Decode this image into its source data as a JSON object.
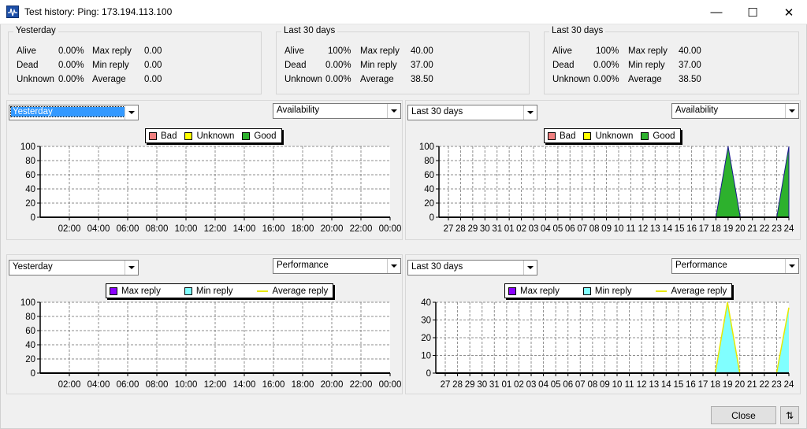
{
  "window": {
    "title": "Test history: Ping: 173.194.113.100",
    "min_glyph": "—",
    "max_glyph": "☐",
    "close_glyph": "✕"
  },
  "stats": [
    {
      "legend": "Yesterday",
      "rows": [
        {
          "label": "Alive",
          "pct": "0.00%",
          "metric": "Max reply",
          "value": "0.00"
        },
        {
          "label": "Dead",
          "pct": "0.00%",
          "metric": "Min reply",
          "value": "0.00"
        },
        {
          "label": "Unknown",
          "pct": "0.00%",
          "metric": "Average",
          "value": "0.00"
        }
      ]
    },
    {
      "legend": "Last 30 days",
      "rows": [
        {
          "label": "Alive",
          "pct": "100%",
          "metric": "Max reply",
          "value": "40.00"
        },
        {
          "label": "Dead",
          "pct": "0.00%",
          "metric": "Min reply",
          "value": "37.00"
        },
        {
          "label": "Unknown",
          "pct": "0.00%",
          "metric": "Average",
          "value": "38.50"
        }
      ]
    },
    {
      "legend": "Last 30 days",
      "rows": [
        {
          "label": "Alive",
          "pct": "100%",
          "metric": "Max reply",
          "value": "40.00"
        },
        {
          "label": "Dead",
          "pct": "0.00%",
          "metric": "Min reply",
          "value": "37.00"
        },
        {
          "label": "Unknown",
          "pct": "0.00%",
          "metric": "Average",
          "value": "38.50"
        }
      ]
    }
  ],
  "panels": [
    {
      "period": "Yesterday",
      "mode": "Availability",
      "legend": [
        "Bad",
        "Unknown",
        "Good"
      ]
    },
    {
      "period": "Last 30 days",
      "mode": "Availability",
      "legend": [
        "Bad",
        "Unknown",
        "Good"
      ]
    },
    {
      "period": "Yesterday",
      "mode": "Performance",
      "legend": [
        "Max reply",
        "Min reply",
        "Average reply"
      ]
    },
    {
      "period": "Last 30 days",
      "mode": "Performance",
      "legend": [
        "Max reply",
        "Min reply",
        "Average reply"
      ]
    }
  ],
  "colors": {
    "bad": "#f08080",
    "unknown": "#ffff00",
    "good": "#2db12d",
    "max_reply": "#8b00ff",
    "min_reply": "#80ffff",
    "avg_reply": "#e8e800"
  },
  "buttons": {
    "close": "Close",
    "resize_glyph": "⇅"
  },
  "chart_data": [
    {
      "type": "area",
      "title": "",
      "x": [
        "02:00",
        "04:00",
        "06:00",
        "08:00",
        "10:00",
        "12:00",
        "14:00",
        "16:00",
        "18:00",
        "20:00",
        "22:00",
        "00:00"
      ],
      "yticks": [
        0,
        20,
        40,
        60,
        80,
        100
      ],
      "ylim": [
        0,
        100
      ],
      "grid": true,
      "legend": "top-center",
      "series": [
        {
          "name": "Bad",
          "values": [
            0,
            0,
            0,
            0,
            0,
            0,
            0,
            0,
            0,
            0,
            0,
            0
          ]
        },
        {
          "name": "Unknown",
          "values": [
            0,
            0,
            0,
            0,
            0,
            0,
            0,
            0,
            0,
            0,
            0,
            0
          ]
        },
        {
          "name": "Good",
          "values": [
            0,
            0,
            0,
            0,
            0,
            0,
            0,
            0,
            0,
            0,
            0,
            0
          ]
        }
      ]
    },
    {
      "type": "area",
      "title": "",
      "x": [
        "27",
        "28",
        "29",
        "30",
        "31",
        "01",
        "02",
        "03",
        "04",
        "05",
        "06",
        "07",
        "08",
        "09",
        "10",
        "11",
        "12",
        "13",
        "14",
        "15",
        "16",
        "17",
        "18",
        "19",
        "20",
        "21",
        "22",
        "23",
        "24"
      ],
      "yticks": [
        0,
        20,
        40,
        60,
        80,
        100
      ],
      "ylim": [
        0,
        100
      ],
      "grid": true,
      "legend": "top-center",
      "series": [
        {
          "name": "Bad",
          "values": [
            0,
            0,
            0,
            0,
            0,
            0,
            0,
            0,
            0,
            0,
            0,
            0,
            0,
            0,
            0,
            0,
            0,
            0,
            0,
            0,
            0,
            0,
            0,
            0,
            0,
            0,
            0,
            0,
            0
          ]
        },
        {
          "name": "Unknown",
          "values": [
            0,
            0,
            0,
            0,
            0,
            0,
            0,
            0,
            0,
            0,
            0,
            0,
            0,
            0,
            0,
            0,
            0,
            0,
            0,
            0,
            0,
            0,
            0,
            0,
            0,
            0,
            0,
            0,
            0
          ]
        },
        {
          "name": "Good",
          "values": [
            0,
            0,
            0,
            0,
            0,
            0,
            0,
            0,
            0,
            0,
            0,
            0,
            0,
            0,
            0,
            0,
            0,
            0,
            0,
            0,
            0,
            0,
            0,
            100,
            0,
            0,
            0,
            0,
            100
          ]
        }
      ]
    },
    {
      "type": "area",
      "title": "",
      "x": [
        "02:00",
        "04:00",
        "06:00",
        "08:00",
        "10:00",
        "12:00",
        "14:00",
        "16:00",
        "18:00",
        "20:00",
        "22:00",
        "00:00"
      ],
      "yticks": [
        0,
        20,
        40,
        60,
        80,
        100
      ],
      "ylim": [
        0,
        100
      ],
      "grid": true,
      "legend": "top-center",
      "series": [
        {
          "name": "Max reply",
          "values": [
            0,
            0,
            0,
            0,
            0,
            0,
            0,
            0,
            0,
            0,
            0,
            0
          ]
        },
        {
          "name": "Min reply",
          "values": [
            0,
            0,
            0,
            0,
            0,
            0,
            0,
            0,
            0,
            0,
            0,
            0
          ]
        },
        {
          "name": "Average reply",
          "values": [
            0,
            0,
            0,
            0,
            0,
            0,
            0,
            0,
            0,
            0,
            0,
            0
          ]
        }
      ]
    },
    {
      "type": "area",
      "title": "",
      "x": [
        "27",
        "28",
        "29",
        "30",
        "31",
        "01",
        "02",
        "03",
        "04",
        "05",
        "06",
        "07",
        "08",
        "09",
        "10",
        "11",
        "12",
        "13",
        "14",
        "15",
        "16",
        "17",
        "18",
        "19",
        "20",
        "21",
        "22",
        "23",
        "24"
      ],
      "yticks": [
        0,
        10,
        20,
        30,
        40
      ],
      "ylim": [
        0,
        40
      ],
      "grid": true,
      "legend": "top-center",
      "series": [
        {
          "name": "Max reply",
          "values": [
            0,
            0,
            0,
            0,
            0,
            0,
            0,
            0,
            0,
            0,
            0,
            0,
            0,
            0,
            0,
            0,
            0,
            0,
            0,
            0,
            0,
            0,
            0,
            40,
            0,
            0,
            0,
            0,
            37
          ]
        },
        {
          "name": "Min reply",
          "values": [
            0,
            0,
            0,
            0,
            0,
            0,
            0,
            0,
            0,
            0,
            0,
            0,
            0,
            0,
            0,
            0,
            0,
            0,
            0,
            0,
            0,
            0,
            0,
            40,
            0,
            0,
            0,
            0,
            37
          ]
        },
        {
          "name": "Average reply",
          "values": [
            0,
            0,
            0,
            0,
            0,
            0,
            0,
            0,
            0,
            0,
            0,
            0,
            0,
            0,
            0,
            0,
            0,
            0,
            0,
            0,
            0,
            0,
            0,
            40,
            0,
            0,
            0,
            0,
            37
          ]
        }
      ]
    }
  ]
}
